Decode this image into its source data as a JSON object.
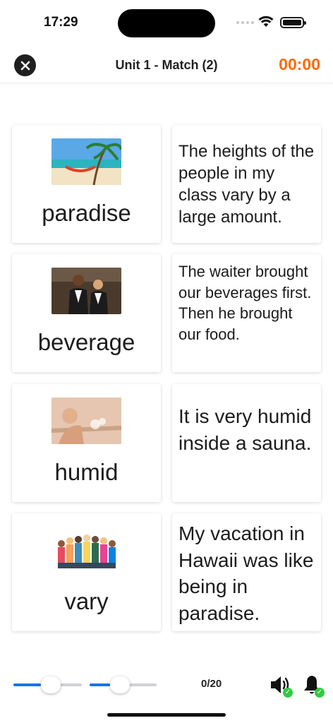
{
  "status_bar": {
    "time": "17:29"
  },
  "header": {
    "title": "Unit 1 - Match (2)",
    "timer": "00:00",
    "timer_color": "#ff6a00"
  },
  "cards": [
    {
      "word": "paradise",
      "image_icon": "beach-hammock-photo",
      "sentence": "The heights of the people in my class vary by a large amount."
    },
    {
      "word": "beverage",
      "image_icon": "waiter-waitress-photo",
      "sentence": "The waiter brought our beverages first. Then he brought our food."
    },
    {
      "word": "humid",
      "image_icon": "sauna-woman-photo",
      "sentence": "It is very humid inside a sauna."
    },
    {
      "word": "vary",
      "image_icon": "group-of-students-photo",
      "sentence": "My vacation in Hawaii was like being in paradise."
    }
  ],
  "controls": {
    "slider1_level": 0.4,
    "slider2_level": 0.3,
    "progress": "0/20",
    "sound_icon": "speaker-icon",
    "bell_icon": "bell-icon",
    "accent": "#1a73e8",
    "check_color": "#2ecc40"
  }
}
